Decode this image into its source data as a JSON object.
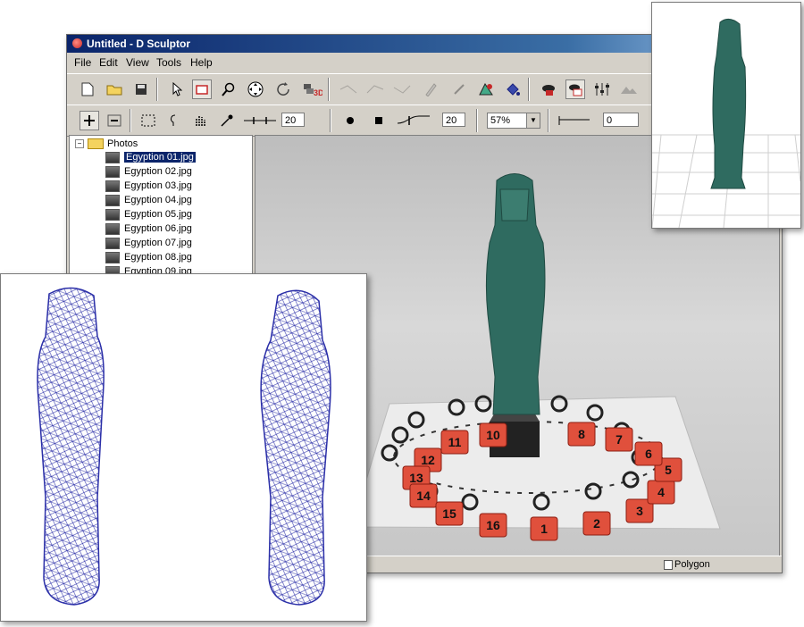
{
  "window": {
    "title": "Untitled - D Sculptor"
  },
  "menu": [
    "File",
    "Edit",
    "View",
    "Tools",
    "Help"
  ],
  "toolbar": {
    "threshold_value": "20",
    "smoothing_value": "20",
    "zoom_value": "57%",
    "offset_value": "0"
  },
  "tree": {
    "root_label": "Photos",
    "items": [
      {
        "label": "Egyption 01.jpg"
      },
      {
        "label": "Egyption 02.jpg"
      },
      {
        "label": "Egyption 03.jpg"
      },
      {
        "label": "Egyption 04.jpg"
      },
      {
        "label": "Egyption 05.jpg"
      },
      {
        "label": "Egyption 06.jpg"
      },
      {
        "label": "Egyption 07.jpg"
      },
      {
        "label": "Egyption 08.jpg"
      },
      {
        "label": "Egyption 09.jpg"
      }
    ]
  },
  "markers": [
    "1",
    "2",
    "3",
    "4",
    "5",
    "6",
    "7",
    "8",
    "10",
    "11",
    "12",
    "13",
    "14",
    "15",
    "16"
  ],
  "status": {
    "mode": "Polygon"
  },
  "colors": {
    "statue": "#2f6b60",
    "marker": "#e0503c",
    "mesh": "#2b2fa8"
  }
}
